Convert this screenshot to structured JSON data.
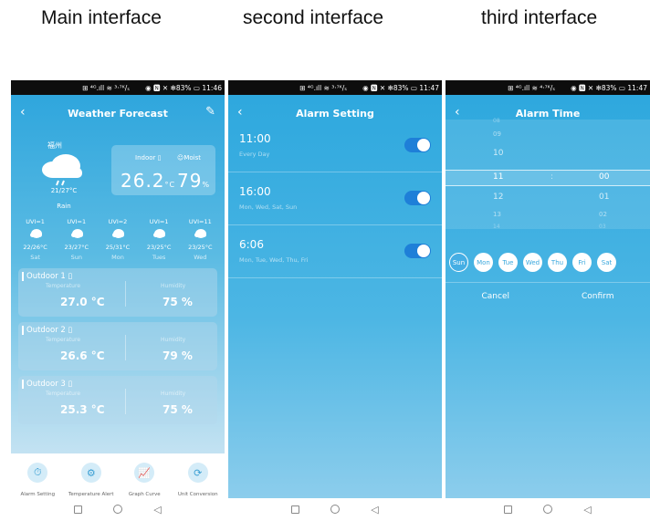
{
  "captions": {
    "main": "Main interface",
    "second": "second interface",
    "third": "third interface"
  },
  "statusbar": {
    "p1": {
      "signal": "⊞ ⁴ᴳ.ıll ≋ ³·⁷ᴷ/ₛ",
      "right": "◉ 🅽 ✕ ✻83% ▭ 11:46"
    },
    "p2": {
      "signal": "⊞ ⁴ᴳ.ıll ≋ ³·⁷ᴷ/ₛ",
      "right": "◉ 🅽 ✕ ✻83% ▭ 11:47"
    },
    "p3": {
      "signal": "⊞ ⁴ᴳ.ıll ≋ ⁴·⁷ᴷ/ₛ",
      "right": "◉ 🅽 ✕ ✻83% ▭ 11:47"
    }
  },
  "main": {
    "title": "Weather Forecast",
    "city": "福州",
    "temp_range": "21/27°C",
    "condition": "Rain",
    "indoor_label": "Indoor",
    "moist_label": "Moist",
    "indoor_temp": "26.2",
    "indoor_temp_unit": "°C",
    "moist_value": "79",
    "moist_unit": "%",
    "forecast": [
      {
        "uvi": "UVI=1",
        "temp": "22/26°C",
        "day": "Sat"
      },
      {
        "uvi": "UVI=1",
        "temp": "23/27°C",
        "day": "Sun"
      },
      {
        "uvi": "UVI=2",
        "temp": "25/31°C",
        "day": "Mon"
      },
      {
        "uvi": "UVI=1",
        "temp": "23/25°C",
        "day": "Tues"
      },
      {
        "uvi": "UVI=11",
        "temp": "23/25°C",
        "day": "Wed"
      }
    ],
    "outdoors": [
      {
        "name": "Outdoor 1",
        "temp_label": "Temperature",
        "hum_label": "Humidity",
        "temp": "27.0 °C",
        "hum": "75 %"
      },
      {
        "name": "Outdoor 2",
        "temp_label": "Temperature",
        "hum_label": "Humidity",
        "temp": "26.6 °C",
        "hum": "79 %"
      },
      {
        "name": "Outdoor 3",
        "temp_label": "Temperature",
        "hum_label": "Humidity",
        "temp": "25.3 °C",
        "hum": "75 %"
      }
    ],
    "bottom": [
      {
        "label": "Alarm Setting",
        "icon": "⏱"
      },
      {
        "label": "Temperature Alert",
        "icon": "⚙"
      },
      {
        "label": "Graph Curve",
        "icon": "📈"
      },
      {
        "label": "Unit Conversion",
        "icon": "⟳"
      }
    ]
  },
  "second": {
    "title": "Alarm Setting",
    "alarms": [
      {
        "time": "11:00",
        "days": "Every Day"
      },
      {
        "time": "16:00",
        "days": "Mon, Wed, Sat, Sun"
      },
      {
        "time": "6:06",
        "days": "Mon, Tue, Wed, Thu, Fri"
      }
    ]
  },
  "third": {
    "title": "Alarm Time",
    "hours": [
      "08",
      "09",
      "10",
      "11",
      "12",
      "13",
      "14"
    ],
    "separator": ":",
    "minutes": [
      "00",
      "01",
      "02",
      "03"
    ],
    "days": [
      "Sun",
      "Mon",
      "Tue",
      "Wed",
      "Thu",
      "Fri",
      "Sat"
    ],
    "cancel": "Cancel",
    "confirm": "Confirm"
  },
  "colors": {
    "accent": "#2ea8de",
    "toggle_on": "#1e7fd8"
  }
}
